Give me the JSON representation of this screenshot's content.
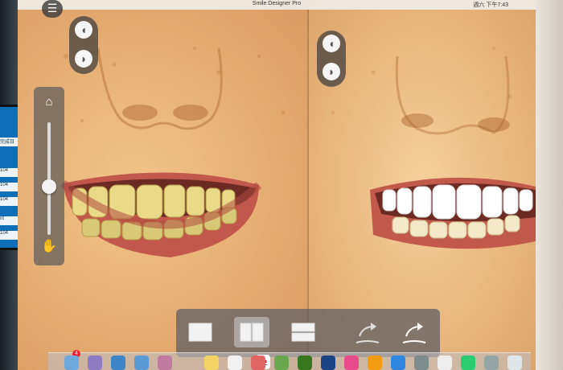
{
  "app": {
    "title": "Smile Designer Pro",
    "clock": "週六 下午7:43"
  },
  "toolbar": {
    "menu_icon": "hamburger-icon",
    "left_toggle": {
      "upper": "tooth-icon",
      "lower": "tooth-icon"
    },
    "right_toggle": {
      "upper": "tooth-icon",
      "lower": "tooth-icon"
    }
  },
  "zoom_panel": {
    "home_icon": "house-magnifier-icon",
    "hand_icon": "hand-icon",
    "zoom_level": 0.25
  },
  "layout_bar": {
    "options": [
      {
        "name": "single-view",
        "active": false
      },
      {
        "name": "side-by-side",
        "active": true
      },
      {
        "name": "top-bottom",
        "active": false
      }
    ],
    "actions": [
      {
        "name": "apply-smile-before",
        "icon": "curved-arrow-icon"
      },
      {
        "name": "apply-smile-after",
        "icon": "curved-arrow-icon"
      }
    ]
  },
  "dock": {
    "calendar_day": "22",
    "badge": "4",
    "apps": [
      "finder",
      "launchpad",
      "safari",
      "mail",
      "contacts",
      "calendar",
      "notes",
      "reminders",
      "photos",
      "messages",
      "numbers",
      "keynote",
      "itunes",
      "ibooks",
      "app-store",
      "system-preferences",
      "smile-designer",
      "maps",
      "preview",
      "trash"
    ]
  },
  "monitor_edge": {
    "cells": [
      "完成日",
      "104",
      "104",
      "104",
      "nt",
      "104"
    ]
  },
  "colors": {
    "accent_active": "#c8c8cd",
    "panel": "#5f5f64",
    "skin": "#e8b57c"
  }
}
